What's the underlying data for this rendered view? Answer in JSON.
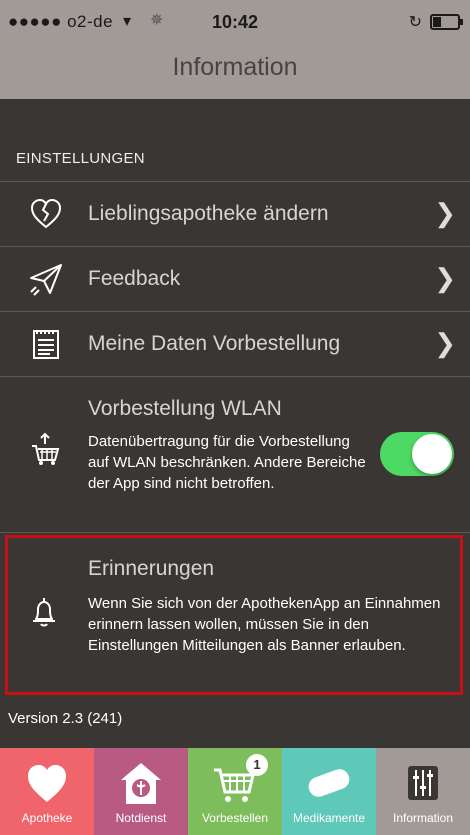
{
  "status": {
    "carrier": "●●●●● o2-de",
    "time": "10:42"
  },
  "navbar": {
    "title": "Information"
  },
  "settings": {
    "section_label": "EINSTELLUNGEN",
    "rows": [
      {
        "label": "Lieblingsapotheke ändern",
        "icon": "heart-broken-icon"
      },
      {
        "label": "Feedback",
        "icon": "paper-plane-icon"
      },
      {
        "label": "Meine Daten Vorbestellung",
        "icon": "notepad-icon"
      }
    ],
    "wlan": {
      "title": "Vorbestellung WLAN",
      "description": "Datenübertragung für die Vorbestellung auf WLAN beschränken. Andere Bereiche der App sind nicht betroffen.",
      "enabled": true
    },
    "reminders": {
      "title": "Erinnerungen",
      "description": "Wenn Sie sich von der ApothekenApp an Einnahmen erinnern lassen wollen, müssen Sie in den Einstellungen Mitteilungen als Banner erlauben."
    }
  },
  "version": "Version 2.3 (241)",
  "tabs": [
    {
      "label": "Apotheke",
      "color": "#f0646c"
    },
    {
      "label": "Notdienst",
      "color": "#b85a82"
    },
    {
      "label": "Vorbestellen",
      "color": "#7dbd5c",
      "badge": "1"
    },
    {
      "label": "Medikamente",
      "color": "#5ec9b8"
    },
    {
      "label": "Information",
      "color": "#a29a97"
    }
  ]
}
